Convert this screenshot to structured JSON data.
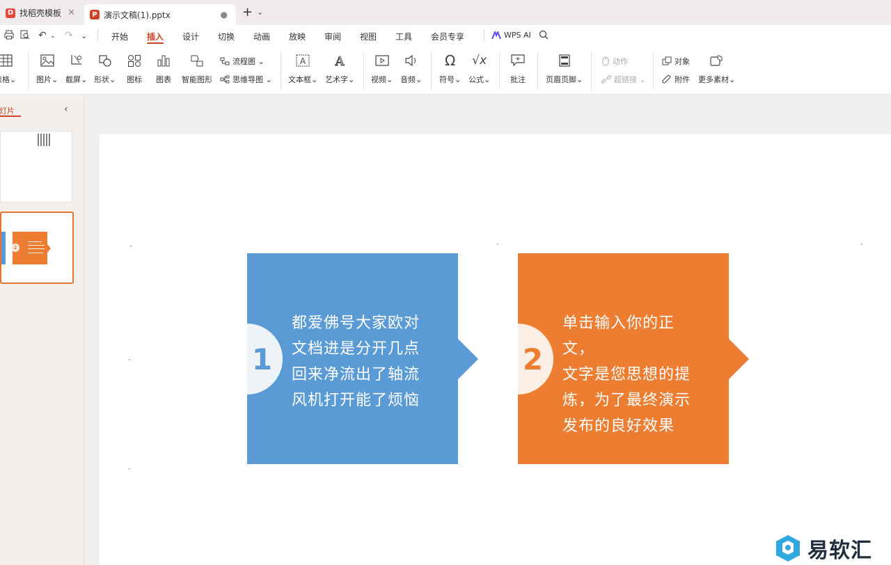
{
  "tabs": [
    {
      "label": "找稻壳模板",
      "icon": "docer-icon"
    },
    {
      "label": "演示文稿(1).pptx",
      "icon": "ppt-icon"
    }
  ],
  "menu": {
    "items": [
      "开始",
      "插入",
      "设计",
      "切换",
      "动画",
      "放映",
      "审阅",
      "视图",
      "工具",
      "会员专享"
    ],
    "active": "插入",
    "wps_ai": "WPS AI"
  },
  "ribbon": {
    "table": "表格",
    "picture": "图片",
    "screenshot": "截屏",
    "shape": "形状",
    "icon": "图标",
    "chart": "图表",
    "smartart": "智能图形",
    "flowchart": "流程图",
    "mindmap": "思维导图",
    "textbox": "文本框",
    "wordart": "艺术字",
    "video": "视频",
    "audio": "音频",
    "symbol": "符号",
    "formula": "公式",
    "comment": "批注",
    "header_footer": "页眉页脚",
    "action": "动作",
    "hyperlink": "超链接",
    "object": "对象",
    "attachment": "附件",
    "more_material": "更多素材"
  },
  "left_panel": {
    "title": "幻灯片"
  },
  "slide": {
    "box1": {
      "number": "1",
      "lines": [
        "都爱佛号大家欧对",
        "文档进是分开几点",
        "回来净流出了轴流",
        "风机打开能了烦恼"
      ]
    },
    "box2": {
      "number": "2",
      "lines": [
        "单击输入你的正文，",
        "文字是您思想的提",
        "炼，为了最终演示",
        "发布的良好效果"
      ]
    }
  },
  "watermark": "易软汇",
  "colors": {
    "accent": "#d24326",
    "blue": "#5b9bd5",
    "orange": "#ed7d31"
  }
}
